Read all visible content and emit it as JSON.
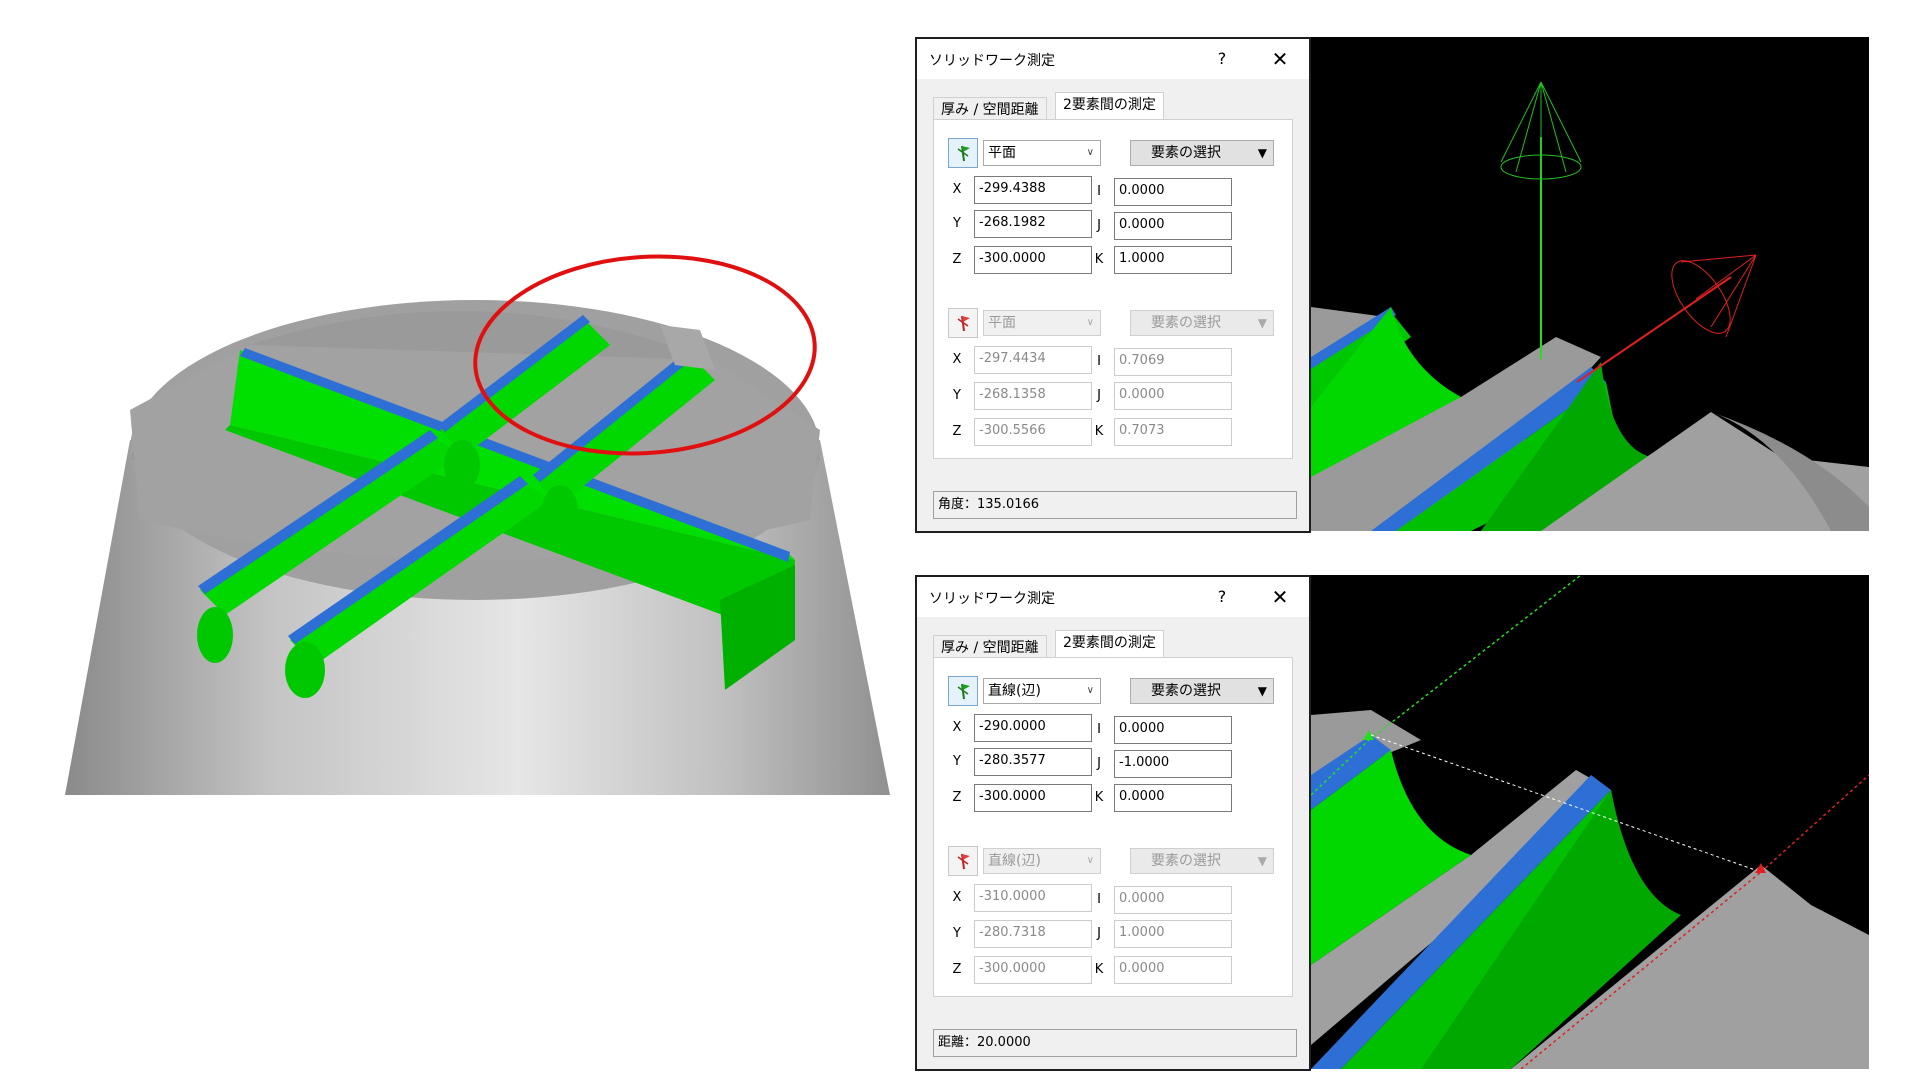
{
  "dialog_top": {
    "title": "ソリッドワーク測定",
    "help": "?",
    "close": "✕",
    "tabs": [
      "厚み / 空間距離",
      "2要素間の測定"
    ],
    "element1": {
      "type": "平面",
      "select_label": "要素の選択",
      "X": "-299.4388",
      "Y": "-268.1982",
      "Z": "-300.0000",
      "I": "0.0000",
      "J": "0.0000",
      "K": "1.0000"
    },
    "element2": {
      "type": "平面",
      "select_label": "要素の選択",
      "X": "-297.4434",
      "Y": "-268.1358",
      "Z": "-300.5566",
      "I": "0.7069",
      "J": "0.0000",
      "K": "0.7073"
    },
    "result": "角度：135.0166"
  },
  "dialog_bottom": {
    "title": "ソリッドワーク測定",
    "help": "?",
    "close": "✕",
    "tabs": [
      "厚み / 空間距離",
      "2要素間の測定"
    ],
    "element1": {
      "type": "直線(辺)",
      "select_label": "要素の選択",
      "X": "-290.0000",
      "Y": "-280.3577",
      "Z": "-300.0000",
      "I": "0.0000",
      "J": "-1.0000",
      "K": "0.0000"
    },
    "element2": {
      "type": "直線(辺)",
      "select_label": "要素の選択",
      "X": "-310.0000",
      "Y": "-280.7318",
      "Z": "-300.0000",
      "I": "0.0000",
      "J": "1.0000",
      "K": "0.0000"
    },
    "result": "距離：20.0000"
  },
  "labels": {
    "x": "X",
    "y": "Y",
    "z": "Z",
    "i": "I",
    "j": "J",
    "k": "K"
  },
  "colors": {
    "highlight_green": "#00e000",
    "highlight_blue": "#2e6fd6",
    "body_gray": "#a0a0a0",
    "annotation_red": "#e01010"
  },
  "icons": {
    "element_select": "pick-flag-icon"
  }
}
